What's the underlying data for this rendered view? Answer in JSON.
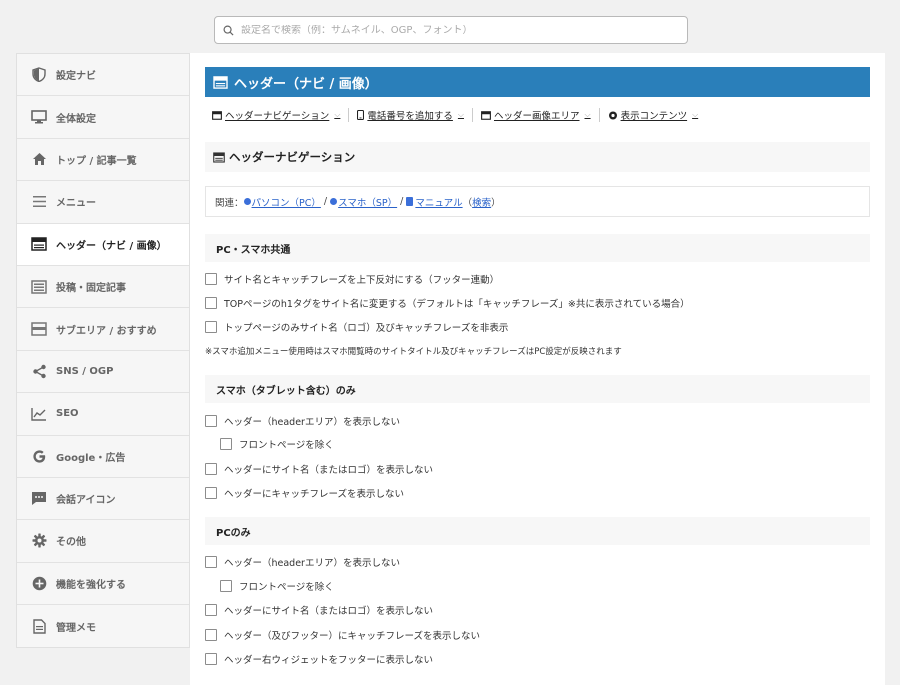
{
  "search": {
    "placeholder": "設定名で検索（例：サムネイル、OGP、フォント）"
  },
  "sidebar": {
    "items": [
      {
        "label": "設定ナビ",
        "icon": "shield-icon"
      },
      {
        "label": "全体設定",
        "icon": "monitor-icon"
      },
      {
        "label": "トップ / 記事一覧",
        "icon": "home-icon"
      },
      {
        "label": "メニュー",
        "icon": "menu-icon"
      },
      {
        "label": "ヘッダー（ナビ / 画像）",
        "icon": "header-icon"
      },
      {
        "label": "投稿・固定記事",
        "icon": "post-icon"
      },
      {
        "label": "サブエリア / おすすめ",
        "icon": "subarea-icon"
      },
      {
        "label": "SNS / OGP",
        "icon": "share-icon"
      },
      {
        "label": "SEO",
        "icon": "chart-icon"
      },
      {
        "label": "Google・広告",
        "icon": "google-icon"
      },
      {
        "label": "会話アイコン",
        "icon": "chat-icon"
      },
      {
        "label": "その他",
        "icon": "gear-icon"
      },
      {
        "label": "機能を強化する",
        "icon": "plus-circle-icon"
      },
      {
        "label": "管理メモ",
        "icon": "document-icon"
      }
    ]
  },
  "main": {
    "title": "ヘッダー（ナビ / 画像）",
    "subnav": [
      {
        "label": "ヘッダーナビゲーション",
        "icon": "header-icon"
      },
      {
        "label": "電話番号を追加する",
        "icon": "phone-icon"
      },
      {
        "label": "ヘッダー画像エリア",
        "icon": "header-icon"
      },
      {
        "label": "表示コンテンツ",
        "icon": "eye-icon"
      }
    ],
    "section_title": "ヘッダーナビゲーション",
    "related": {
      "prefix": "関連：",
      "link_pc": "パソコン（PC）",
      "sep1": " / ",
      "link_sp": "スマホ（SP）",
      "sep2": " / ",
      "link_manual": "マニュアル",
      "paren_open": "（",
      "link_search": "検索",
      "paren_close": "）"
    },
    "groups": {
      "common": {
        "title": "PC・スマホ共通",
        "options": [
          "サイト名とキャッチフレーズを上下反対にする（フッター連動）",
          "TOPページのh1タグをサイト名に変更する（デフォルトは「キャッチフレーズ」※共に表示されている場合）",
          "トップページのみサイト名（ロゴ）及びキャッチフレーズを非表示"
        ],
        "note": "※スマホ追加メニュー使用時はスマホ閲覧時のサイトタイトル及びキャッチフレーズはPC設定が反映されます"
      },
      "smartphone": {
        "title": "スマホ（タブレット含む）のみ",
        "options": [
          "ヘッダー（headerエリア）を表示しない",
          "フロントページを除く",
          "ヘッダーにサイト名（またはロゴ）を表示しない",
          "ヘッダーにキャッチフレーズを表示しない"
        ]
      },
      "pc": {
        "title": "PCのみ",
        "options": [
          "ヘッダー（headerエリア）を表示しない",
          "フロントページを除く",
          "ヘッダーにサイト名（またはロゴ）を表示しない",
          "ヘッダー（及びフッター）にキャッチフレーズを表示しない",
          "ヘッダー右ウィジェットをフッターに表示しない"
        ]
      }
    }
  },
  "colors": {
    "accent": "#2a7fba",
    "link": "#2a62c9"
  }
}
